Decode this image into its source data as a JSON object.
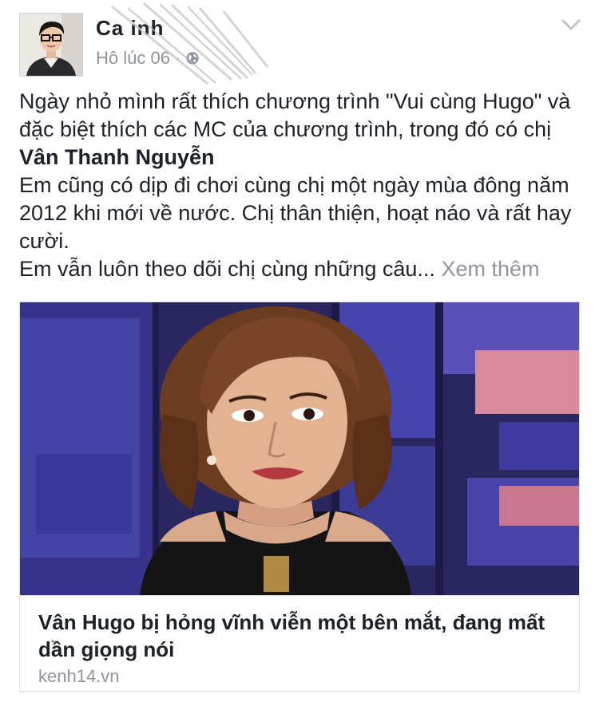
{
  "post": {
    "author_name": "Ca          inh",
    "timestamp": "Hô        lúc    06",
    "separator": "·",
    "privacy_icon": "globe-icon",
    "menu_icon": "chevron-down-icon",
    "avatar_icon": "profile-photo"
  },
  "content": {
    "para1_pre": "Ngày nhỏ mình rất thích chương trình \"Vui cùng Hugo\" và đặc biệt thích các MC của chương trình, trong đó có chị ",
    "para1_bold": "Vân Thanh Nguyễn",
    "para2": "Em cũng có dịp đi chơi cùng chị một ngày mùa đông năm 2012 khi mới về nước. Chị thân thiện, hoạt náo và rất hay cười.",
    "para3": "Em vẫn luôn theo dõi chị cùng những câu...",
    "see_more": "Xem thêm"
  },
  "link_card": {
    "image": "news-photo",
    "title": "Vân Hugo bị hỏng vĩnh viễn một bên mắt, đang mất dần giọng nói",
    "domain": "kenh14.vn"
  },
  "colors": {
    "text": "#1d2129",
    "muted": "#90949c",
    "border": "#dddfe2"
  }
}
